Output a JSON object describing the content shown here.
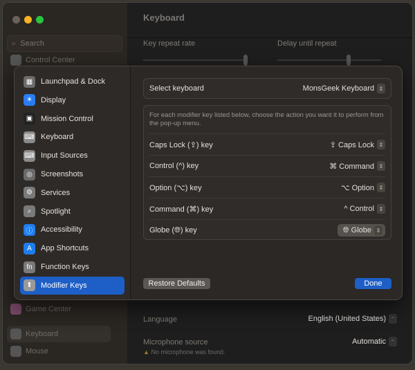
{
  "window": {
    "title": "Keyboard",
    "search_placeholder": "Search"
  },
  "bg_sidebar": {
    "items": [
      {
        "label": "Control Center"
      },
      {
        "label": "Game Center"
      },
      {
        "label": "Keyboard"
      },
      {
        "label": "Mouse"
      }
    ]
  },
  "bg_main": {
    "key_repeat_rate": "Key repeat rate",
    "delay_until_repeat": "Delay until repeat",
    "language_label": "Language",
    "language_value": "English (United States)",
    "mic_label": "Microphone source",
    "mic_value": "Automatic",
    "mic_warning": "No microphone was found."
  },
  "sheet": {
    "sidebar": [
      {
        "label": "Launchpad & Dock",
        "color": "#6b6b6b"
      },
      {
        "label": "Display",
        "color": "#2b7cf0"
      },
      {
        "label": "Mission Control",
        "color": "#222"
      },
      {
        "label": "Keyboard",
        "color": "#8a8a8a"
      },
      {
        "label": "Input Sources",
        "color": "#8a8a8a"
      },
      {
        "label": "Screenshots",
        "color": "#6a6a6a"
      },
      {
        "label": "Services",
        "color": "#7a7a7a"
      },
      {
        "label": "Spotlight",
        "color": "#7a7a7a"
      },
      {
        "label": "Accessibility",
        "color": "#1e7ef0"
      },
      {
        "label": "App Shortcuts",
        "color": "#1e7ef0"
      },
      {
        "label": "Function Keys",
        "color": "#7a7a7a"
      },
      {
        "label": "Modifier Keys",
        "color": "#9a9a9a"
      }
    ],
    "select_keyboard_label": "Select keyboard",
    "select_keyboard_value": "MonsGeek  Keyboard",
    "description": "For each modifier key listed below, choose the action you want it to perform from the pop-up menu.",
    "rows": [
      {
        "label": "Caps Lock (⇪) key",
        "value": "⇪ Caps Lock"
      },
      {
        "label": "Control (^) key",
        "value": "⌘ Command"
      },
      {
        "label": "Option (⌥) key",
        "value": "⌥ Option"
      },
      {
        "label": "Command (⌘) key",
        "value": "^ Control"
      },
      {
        "label": "Globe (🌐︎) key",
        "value": "🌐︎ Globe"
      }
    ],
    "restore_defaults": "Restore Defaults",
    "done": "Done"
  },
  "colors": {
    "accent": "#1d5fc7"
  }
}
